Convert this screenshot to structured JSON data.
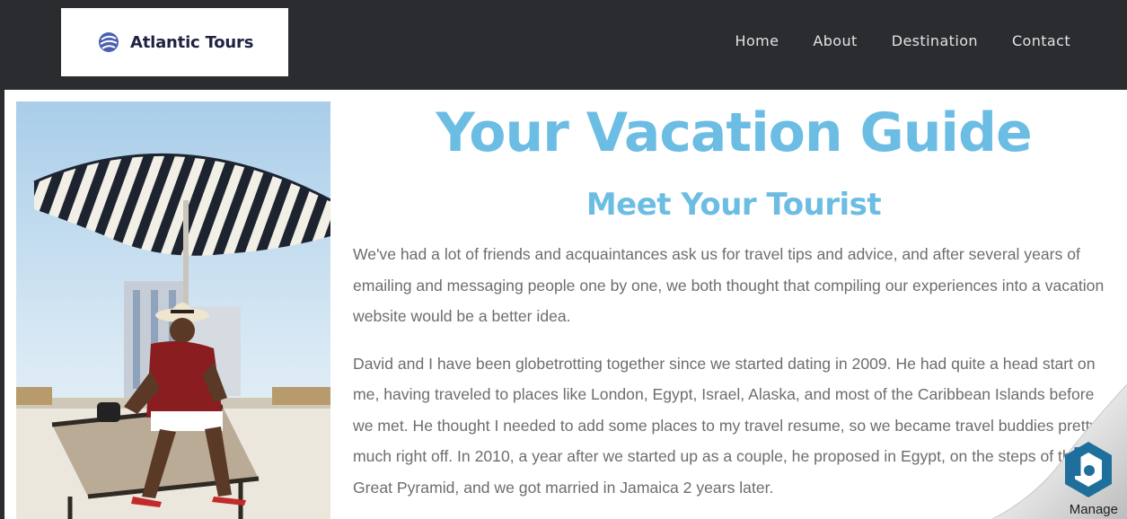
{
  "header": {
    "logo_text": "Atlantic Tours",
    "nav": [
      "Home",
      "About",
      "Destination",
      "Contact"
    ]
  },
  "hero": {
    "title": "Your Vacation Guide",
    "subtitle": "Meet Your Tourist"
  },
  "paragraphs": [
    "We've had a lot of friends and acquaintances ask us for travel tips and advice, and after several years of emailing and messaging people one by one, we both thought that compiling our experiences into a vacation website would be a better idea.",
    "David and I have been globetrotting together since we started dating in 2009. He had quite a head start on me, having traveled to places like London, Egypt, Israel, Alaska, and most of the Caribbean Islands before we met. He thought I needed to add some places to my travel resume, so we became travel buddies pretty much right off. In 2010, a year after we started up as a couple, he proposed in Egypt, on the steps of the Great Pyramid, and we got married in Jamaica 2 years later."
  ],
  "manage_widget": {
    "label": "Manage"
  },
  "colors": {
    "header_bg": "#2b2c30",
    "accent": "#6cbde3",
    "body_text": "#6d6d6d",
    "nav_text": "#e2e2e4"
  },
  "icons": [
    "logo-swirl-icon",
    "manage-hexagon-icon"
  ]
}
